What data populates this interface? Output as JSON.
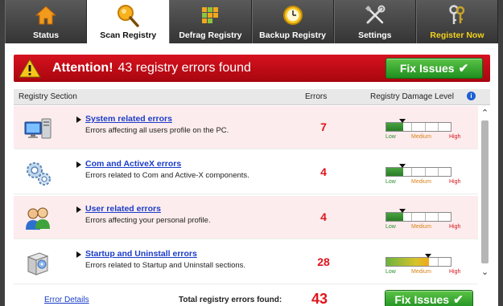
{
  "tabs": [
    {
      "label": "Status",
      "icon": "home-icon"
    },
    {
      "label": "Scan Registry",
      "icon": "magnifier-icon"
    },
    {
      "label": "Defrag Registry",
      "icon": "blocks-icon"
    },
    {
      "label": "Backup Registry",
      "icon": "clock-icon"
    },
    {
      "label": "Settings",
      "icon": "tools-icon"
    },
    {
      "label": "Register Now",
      "icon": "keys-icon"
    }
  ],
  "active_tab": "Scan Registry",
  "banner": {
    "strong": "Attention!",
    "text": "43 registry errors found",
    "button": "Fix Issues"
  },
  "table": {
    "headers": {
      "section": "Registry Section",
      "errors": "Errors",
      "level": "Registry Damage Level"
    },
    "level_labels": {
      "low": "Low",
      "medium": "Medium",
      "high": "High"
    },
    "rows": [
      {
        "title": "System related errors",
        "description": "Errors affecting all users profile on the PC.",
        "errors": "7",
        "icon": "computer-icon",
        "damage_level": 0.25
      },
      {
        "title": "Com and ActiveX errors",
        "description": "Errors related to Com and Active-X components.",
        "errors": "4",
        "icon": "gears-icon",
        "damage_level": 0.25
      },
      {
        "title": "User related errors",
        "description": "Errors affecting your personal profile.",
        "errors": "4",
        "icon": "users-icon",
        "damage_level": 0.25
      },
      {
        "title": "Startup and Uninstall errors",
        "description": "Errors related to Startup and Uninstall sections.",
        "errors": "28",
        "icon": "software-box-icon",
        "damage_level": 0.65
      }
    ]
  },
  "footer": {
    "details_link": "Error Details",
    "total_label": "Total registry errors found:",
    "total_count": "43",
    "button": "Fix Issues"
  },
  "colors": {
    "banner_red": "#c40c16",
    "button_green": "#2fa52f",
    "error_red": "#e0141d",
    "link_blue": "#1a3cc8",
    "register_yellow": "#f4d21c"
  }
}
